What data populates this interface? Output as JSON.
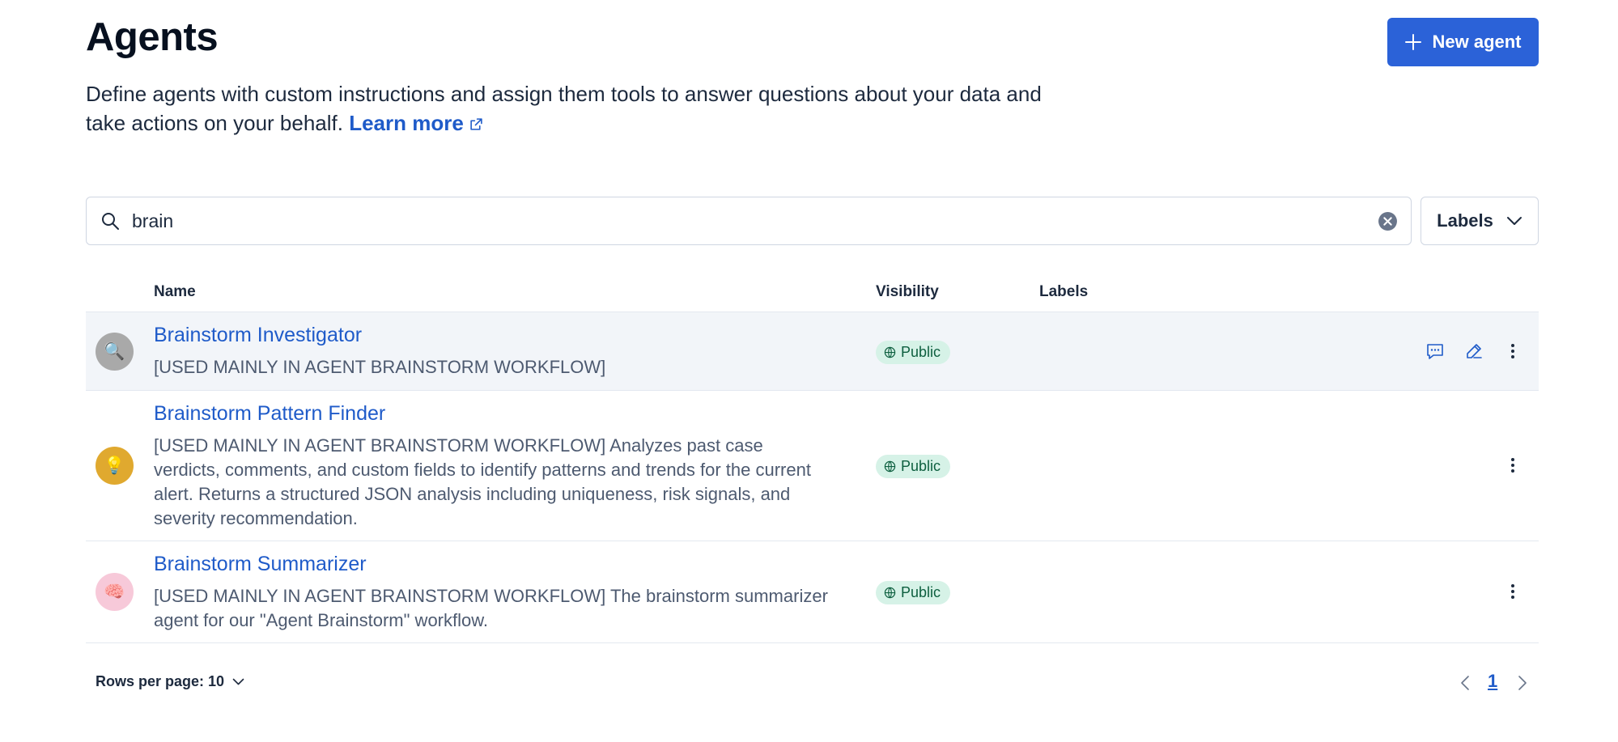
{
  "header": {
    "title": "Agents",
    "new_agent_label": "New agent",
    "description": "Define agents with custom instructions and assign them tools to answer questions about your data and take actions on your behalf.",
    "learn_more": "Learn more"
  },
  "search": {
    "value": "brain",
    "placeholder": "Search"
  },
  "filters": {
    "labels": "Labels"
  },
  "table": {
    "columns": {
      "name": "Name",
      "visibility": "Visibility",
      "labels": "Labels"
    },
    "rows": [
      {
        "name": "Brainstorm Investigator",
        "description": "[USED MAINLY IN AGENT BRAINSTORM WORKFLOW]",
        "visibility": "Public",
        "avatar": "🔍",
        "avatar_color": "#a9a9a9"
      },
      {
        "name": "Brainstorm Pattern Finder",
        "description": "[USED MAINLY IN AGENT BRAINSTORM WORKFLOW] Analyzes past case verdicts, comments, and custom fields to identify patterns and trends for the current alert. Returns a structured JSON analysis including uniqueness, risk signals, and severity recommendation.",
        "visibility": "Public",
        "avatar": "💡",
        "avatar_color": "#e0a92f"
      },
      {
        "name": "Brainstorm Summarizer",
        "description": "[USED MAINLY IN AGENT BRAINSTORM WORKFLOW] The brainstorm summarizer agent for our \"Agent Brainstorm\" workflow.",
        "visibility": "Public",
        "avatar": "🧠",
        "avatar_color": "#f7c9d9"
      }
    ]
  },
  "pagination": {
    "rows_per_page": "Rows per page: 10",
    "current_page": "1"
  },
  "colors": {
    "accent": "#2b62d8",
    "link": "#1f5bc9",
    "badge_bg": "#d6f2e7",
    "badge_text": "#0d5f3f",
    "row_highlight": "#f2f5f9"
  }
}
